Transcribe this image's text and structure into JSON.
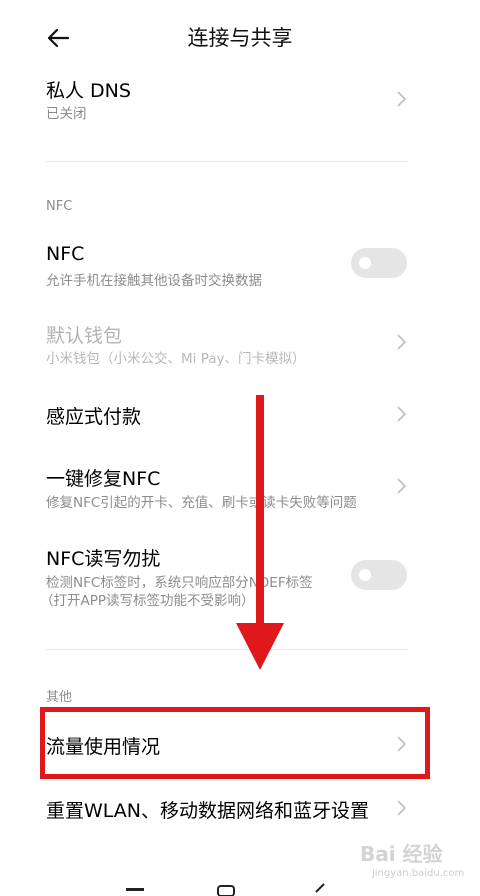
{
  "header": {
    "title": "连接与共享"
  },
  "items": {
    "private_dns": {
      "title": "私人 DNS",
      "subtitle": "已关闭"
    },
    "nfc_section": "NFC",
    "nfc": {
      "title": "NFC",
      "subtitle": "允许手机在接触其他设备时交换数据",
      "enabled": false
    },
    "default_wallet": {
      "title": "默认钱包",
      "subtitle": "小米钱包（小米公交、Mi Pay、门卡模拟）"
    },
    "contactless_pay": {
      "title": "感应式付款"
    },
    "nfc_repair": {
      "title": "一键修复NFC",
      "subtitle": "修复NFC引起的开卡、充值、刷卡或读卡失败等问题"
    },
    "nfc_dnd": {
      "title": "NFC读写勿扰",
      "subtitle1": "检测NFC标签时，系统只响应部分NDEF标签",
      "subtitle2": "（打开APP读写标签功能不受影响）",
      "enabled": false
    },
    "other_section": "其他",
    "data_usage": {
      "title": "流量使用情况"
    },
    "reset_network": {
      "title": "重置WLAN、移动数据网络和蓝牙设置"
    }
  },
  "watermark": {
    "brand": "Bai 经验",
    "url": "jingyan.baidu.com"
  },
  "colors": {
    "annotation_red": "#e0181c",
    "toggle_off": "#e5e5e5"
  }
}
